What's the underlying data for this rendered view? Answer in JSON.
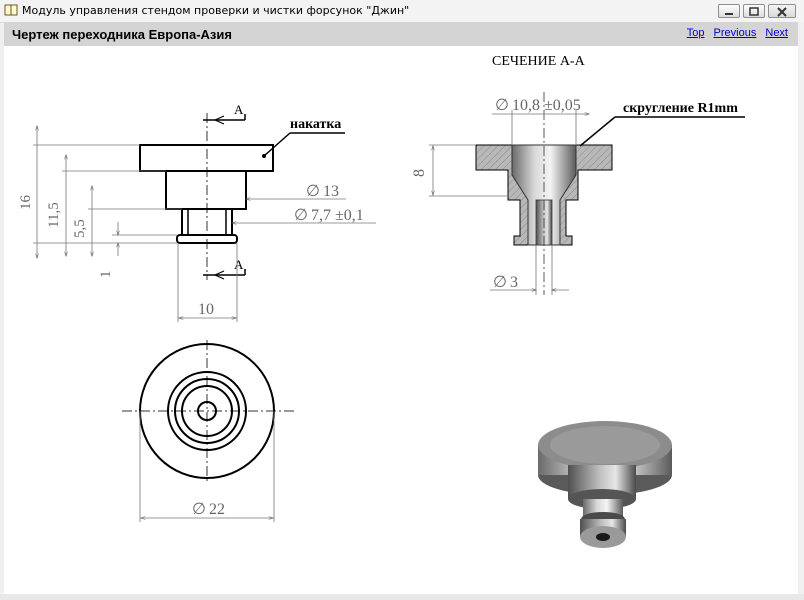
{
  "window": {
    "title": "Модуль управления стендом проверки и чистки форсунок \"Джин\""
  },
  "header": {
    "title": "Чертеж переходника Европа-Азия",
    "links": {
      "top": "Top",
      "previous": "Previous",
      "next": "Next"
    }
  },
  "drawing": {
    "section_title": "СЕЧЕНИЕ А-А",
    "section_mark_top": "А",
    "section_mark_bottom": "А",
    "knurl_label": "накатка",
    "fillet_label": "скругление R1mm",
    "dims": {
      "d13": "13",
      "d77": "7,7 ±0,1",
      "h16": "16",
      "h115": "11,5",
      "h55": "5,5",
      "h1": "1",
      "w10": "10",
      "d22": "22",
      "d108": "10,8 ±0,05",
      "h8": "8",
      "d3": "3"
    }
  }
}
